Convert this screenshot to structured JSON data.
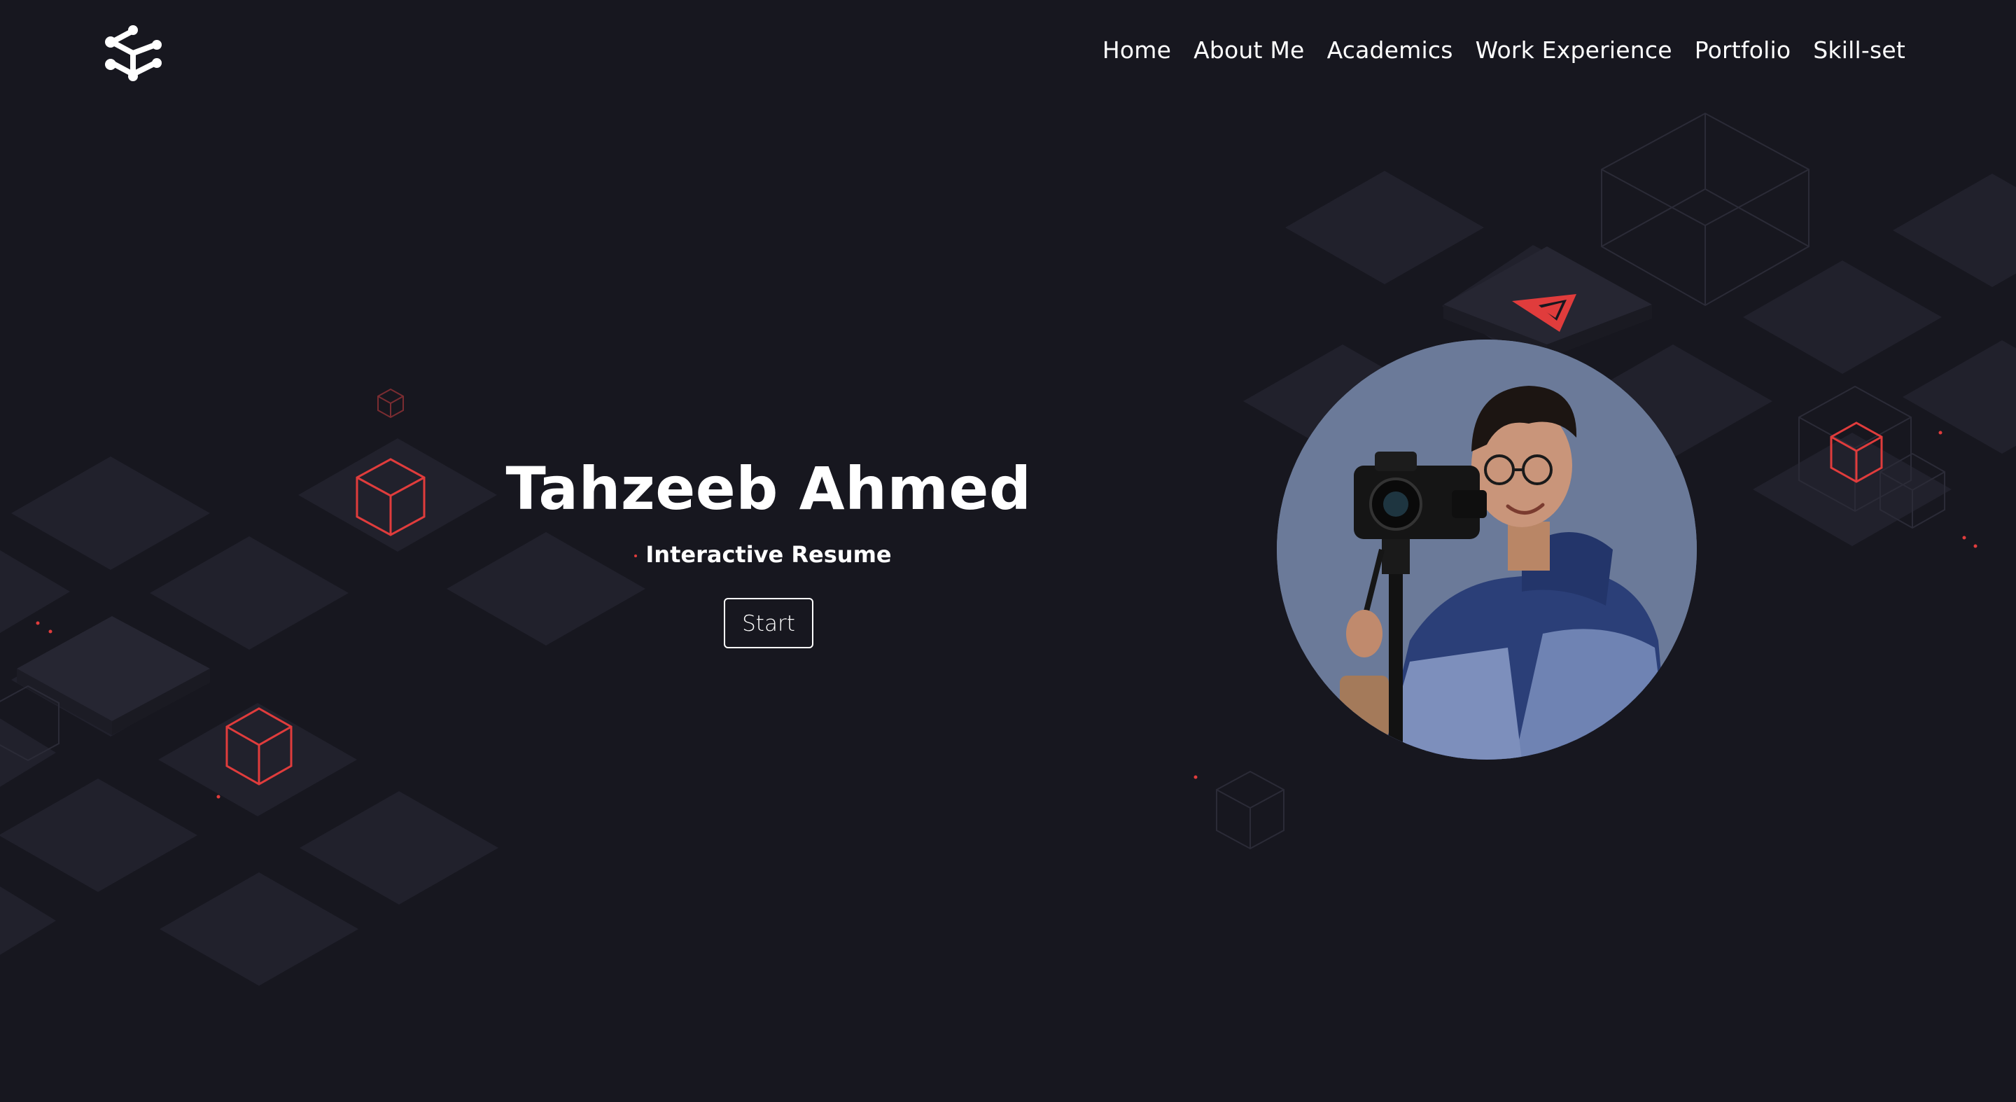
{
  "nav": {
    "items": [
      {
        "label": "Home"
      },
      {
        "label": "About Me"
      },
      {
        "label": "Academics"
      },
      {
        "label": "Work Experience"
      },
      {
        "label": "Portfolio"
      },
      {
        "label": "Skill-set"
      }
    ]
  },
  "hero": {
    "name": "Tahzeeb Ahmed",
    "subtitle": "Interactive Resume",
    "start_label": "Start"
  },
  "icons": {
    "logo": "logo-network-icon",
    "paper_plane": "paper-plane-icon",
    "cube": "cube-icon"
  },
  "colors": {
    "background": "#17171f",
    "tile": "#22222d",
    "accent": "#e03c3c",
    "text": "#ffffff",
    "photo_bg": "#6b7a99"
  }
}
